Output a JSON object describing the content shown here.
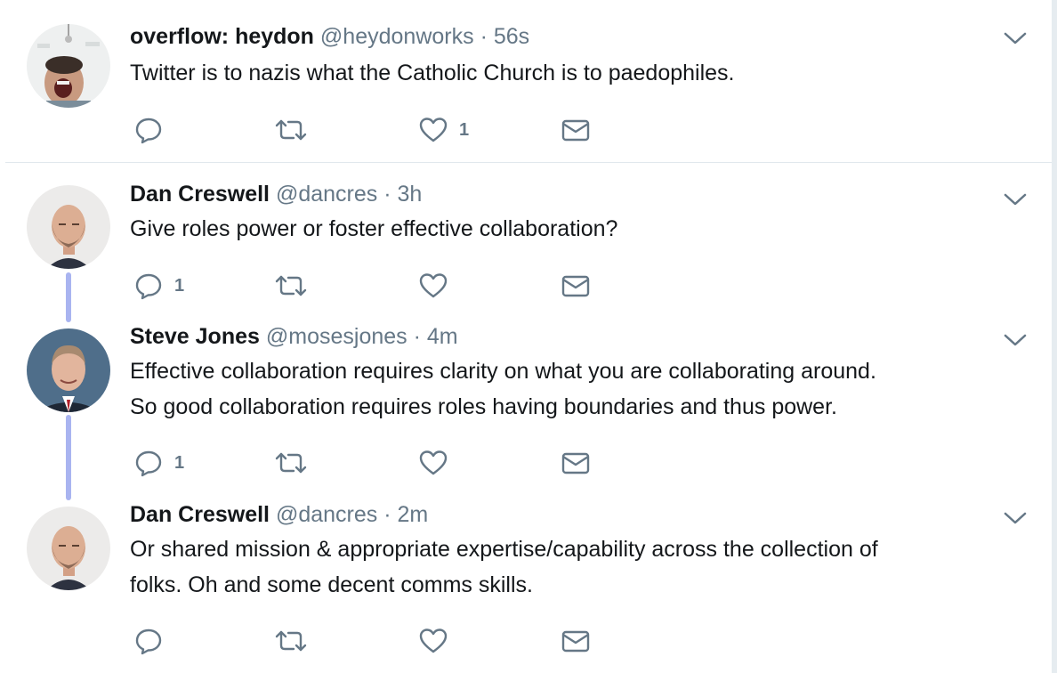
{
  "tweets": [
    {
      "name": "overflow: heydon",
      "handle": "@heydonworks",
      "separator": "·",
      "time": "56s",
      "lines": [
        "Twitter is to nazis what the Catholic Church is to paedophiles."
      ],
      "reply_count": "",
      "like_count": "1"
    },
    {
      "name": "Dan Creswell",
      "handle": "@dancres",
      "separator": "·",
      "time": "3h",
      "lines": [
        "Give roles power or foster effective collaboration?"
      ],
      "reply_count": "1",
      "like_count": ""
    },
    {
      "name": "Steve Jones",
      "handle": "@mosesjones",
      "separator": "·",
      "time": "4m",
      "lines": [
        "Effective collaboration requires clarity on what you are collaborating around.",
        "So good collaboration requires roles having boundaries and thus power."
      ],
      "reply_count": "1",
      "like_count": ""
    },
    {
      "name": "Dan Creswell",
      "handle": "@dancres",
      "separator": "·",
      "time": "2m",
      "lines": [
        "Or shared mission & appropriate expertise/capability across the collection of",
        "folks. Oh and some decent comms skills."
      ],
      "reply_count": "",
      "like_count": ""
    }
  ],
  "icons": {
    "reply": "reply-icon",
    "retweet": "retweet-icon",
    "like": "heart-icon",
    "dm": "envelope-icon",
    "menu": "chevron-down-icon"
  },
  "colors": {
    "icon": "#657786",
    "thread_line": "#a9b4f0",
    "divider": "#e1e8ed"
  }
}
